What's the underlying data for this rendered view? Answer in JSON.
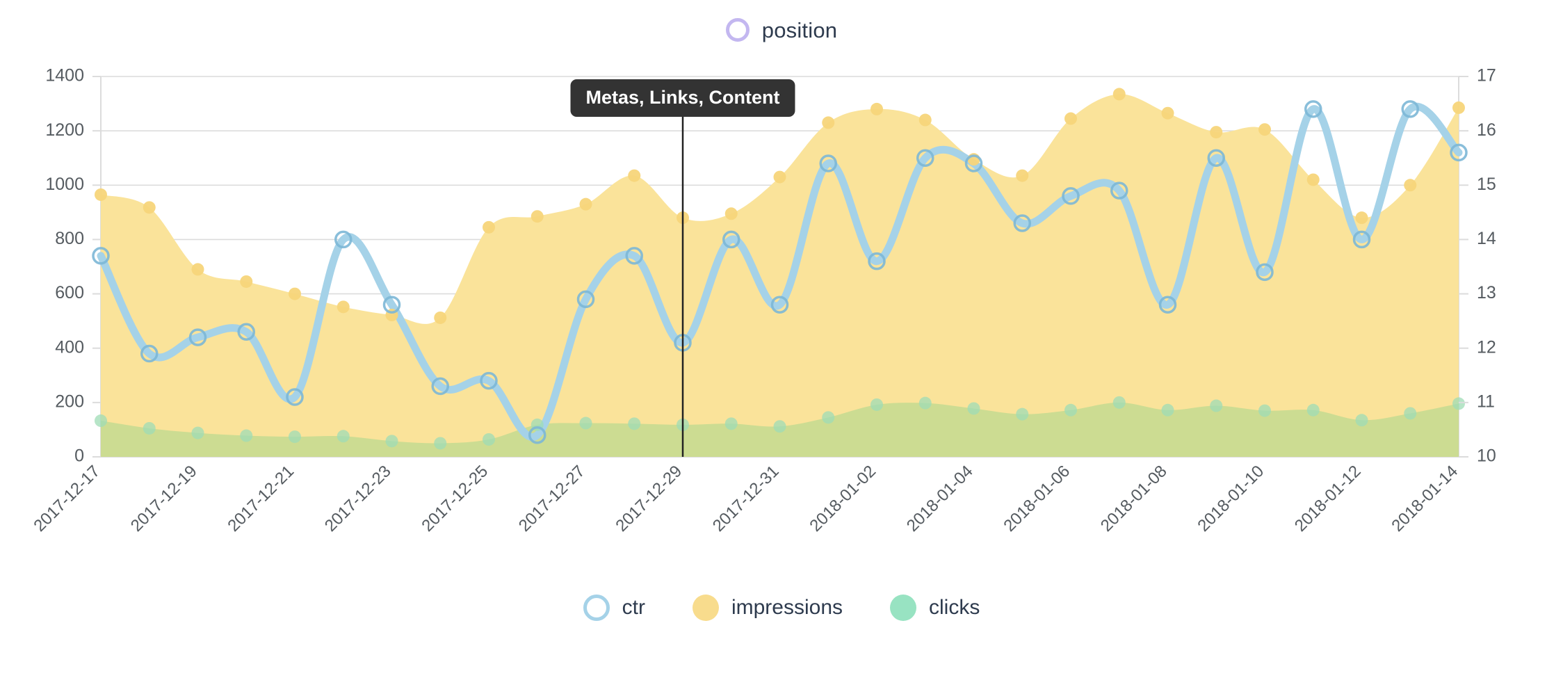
{
  "top_legend": {
    "items": [
      {
        "label": "position",
        "marker": "ring",
        "color": "#c3b7f0",
        "icon": "circle-outline-icon"
      }
    ]
  },
  "bottom_legend": {
    "items": [
      {
        "label": "ctr",
        "marker": "ring",
        "color": "#a5d2e8",
        "icon": "circle-outline-icon"
      },
      {
        "label": "impressions",
        "marker": "dot",
        "color": "#f8dc8d",
        "icon": "circle-filled-icon"
      },
      {
        "label": "clicks",
        "marker": "dot",
        "color": "#98e3c2",
        "icon": "circle-filled-icon"
      }
    ]
  },
  "annotation": {
    "label": "Metas, Links, Content",
    "date": "2017-12-29",
    "pill_bg": "#333333",
    "pill_color": "#ffffff",
    "line_color": "#222222"
  },
  "colors": {
    "impressions_fill": "#fae39a",
    "impressions_marker": "#f7d57a",
    "clicks_fill": "#ccdc92",
    "clicks_marker": "#9fdcb6",
    "ctr_line": "#a5d2e8",
    "ctr_marker_stroke": "#7cb7d6",
    "grid": "#dcdcdc",
    "axis_text": "#555b60",
    "legend_text": "#2e3b4e",
    "position": "#c3b7f0"
  },
  "chart_data": {
    "type": "area",
    "title": "",
    "xlabel": "",
    "ylabel": "",
    "grid": true,
    "legend_position": "bottom",
    "x": [
      "2017-12-17",
      "2017-12-18",
      "2017-12-19",
      "2017-12-20",
      "2017-12-21",
      "2017-12-22",
      "2017-12-23",
      "2017-12-24",
      "2017-12-25",
      "2017-12-26",
      "2017-12-27",
      "2017-12-28",
      "2017-12-29",
      "2017-12-30",
      "2017-12-31",
      "2018-01-01",
      "2018-01-02",
      "2018-01-03",
      "2018-01-04",
      "2018-01-05",
      "2018-01-06",
      "2018-01-07",
      "2018-01-08",
      "2018-01-09",
      "2018-01-10",
      "2018-01-11",
      "2018-01-12",
      "2018-01-13",
      "2018-01-14"
    ],
    "x_tick_labels": [
      "2017-12-17",
      "2017-12-19",
      "2017-12-21",
      "2017-12-23",
      "2017-12-25",
      "2017-12-27",
      "2017-12-29",
      "2017-12-31",
      "2018-01-02",
      "2018-01-04",
      "2018-01-06",
      "2018-01-08",
      "2018-01-10",
      "2018-01-12",
      "2018-01-14"
    ],
    "x_tick_every": 2,
    "left_axis": {
      "label": "",
      "min": 0,
      "max": 1400,
      "step": 200,
      "ticks": [
        0,
        200,
        400,
        600,
        800,
        1000,
        1200,
        1400
      ]
    },
    "right_axis": {
      "label": "",
      "min": 10,
      "max": 17,
      "step": 1,
      "ticks": [
        10,
        11,
        12,
        13,
        14,
        15,
        16,
        17
      ]
    },
    "series": [
      {
        "name": "impressions",
        "type": "area",
        "axis": "left",
        "color": "#fae39a",
        "values": [
          965,
          918,
          690,
          645,
          600,
          552,
          522,
          512,
          845,
          885,
          930,
          1035,
          880,
          895,
          1030,
          1230,
          1280,
          1240,
          1095,
          1035,
          1245,
          1335,
          1265,
          1195,
          1205,
          1020,
          880,
          1000,
          1285
        ]
      },
      {
        "name": "clicks",
        "type": "area",
        "axis": "left",
        "color": "#9fdcb6",
        "values": [
          133,
          105,
          88,
          78,
          74,
          76,
          58,
          50,
          64,
          118,
          124,
          122,
          118,
          122,
          112,
          145,
          192,
          198,
          178,
          157,
          172,
          200,
          172,
          188,
          170,
          172,
          135,
          160,
          196
        ]
      },
      {
        "name": "ctr",
        "type": "line",
        "axis": "right",
        "color": "#a5d2e8",
        "values": [
          13.7,
          11.9,
          12.2,
          12.3,
          11.1,
          14.0,
          12.8,
          11.3,
          11.4,
          10.4,
          12.9,
          13.7,
          12.1,
          14.0,
          12.8,
          15.4,
          13.6,
          15.5,
          15.4,
          14.3,
          14.8,
          14.9,
          12.8,
          15.5,
          13.4,
          16.4,
          14.0,
          16.4,
          15.6
        ]
      },
      {
        "name": "position",
        "type": "line",
        "axis": "right",
        "color": "#c3b7f0",
        "values": []
      }
    ]
  }
}
